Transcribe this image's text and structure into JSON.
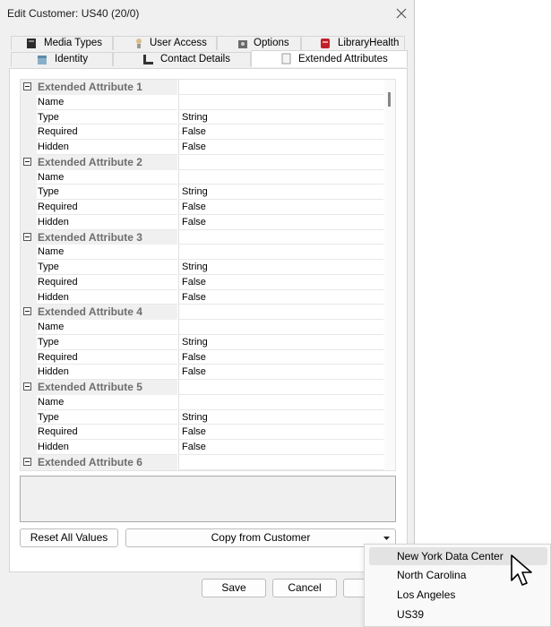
{
  "window": {
    "title": "Edit Customer: US40 (20/0)"
  },
  "tabs_top": [
    {
      "label": "Media Types",
      "icon": "media-types-icon"
    },
    {
      "label": "User Access",
      "icon": "user-access-icon"
    },
    {
      "label": "Options",
      "icon": "options-icon"
    },
    {
      "label": "LibraryHealth",
      "icon": "library-health-icon"
    }
  ],
  "tabs_bottom": [
    {
      "label": "Identity",
      "icon": "identity-icon"
    },
    {
      "label": "Contact Details",
      "icon": "contact-details-icon"
    },
    {
      "label": "Extended Attributes",
      "icon": "extended-attributes-icon",
      "active": true
    }
  ],
  "property_grid": {
    "categories": [
      {
        "title": "Extended Attribute 1",
        "rows": [
          [
            "Name",
            ""
          ],
          [
            "Type",
            "String"
          ],
          [
            "Required",
            "False"
          ],
          [
            "Hidden",
            "False"
          ]
        ]
      },
      {
        "title": "Extended Attribute 2",
        "rows": [
          [
            "Name",
            ""
          ],
          [
            "Type",
            "String"
          ],
          [
            "Required",
            "False"
          ],
          [
            "Hidden",
            "False"
          ]
        ]
      },
      {
        "title": "Extended Attribute 3",
        "rows": [
          [
            "Name",
            ""
          ],
          [
            "Type",
            "String"
          ],
          [
            "Required",
            "False"
          ],
          [
            "Hidden",
            "False"
          ]
        ]
      },
      {
        "title": "Extended Attribute 4",
        "rows": [
          [
            "Name",
            ""
          ],
          [
            "Type",
            "String"
          ],
          [
            "Required",
            "False"
          ],
          [
            "Hidden",
            "False"
          ]
        ]
      },
      {
        "title": "Extended Attribute 5",
        "rows": [
          [
            "Name",
            ""
          ],
          [
            "Type",
            "String"
          ],
          [
            "Required",
            "False"
          ],
          [
            "Hidden",
            "False"
          ]
        ]
      },
      {
        "title": "Extended Attribute 6",
        "rows": []
      }
    ]
  },
  "buttons": {
    "reset_all": "Reset All Values",
    "copy_from_customer": "Copy from Customer",
    "save": "Save",
    "cancel": "Cancel"
  },
  "dropdown_menu": {
    "items": [
      "New York Data Center",
      "North Carolina",
      "Los Angeles",
      "US39"
    ],
    "highlighted_index": 0
  },
  "colors": {
    "dialog_bg": "#f0f0f0",
    "category_text": "#6d6d6d",
    "highlight": "#e3e3e3"
  }
}
